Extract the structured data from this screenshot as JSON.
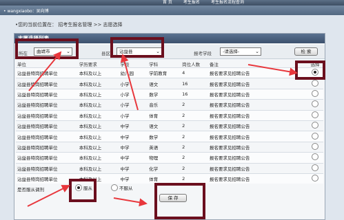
{
  "topbar": {
    "tabs": [
      "首 页",
      "考生报名",
      "考生报名流程查询"
    ]
  },
  "subbar": {
    "user": "• wangxiaobo：吴向博"
  },
  "breadcrumb": "•您的当前位置在：   招考生报名管理 >> 志愿选择",
  "panel_title": "志愿选择列表",
  "filters": {
    "region_label": "所在",
    "region_value": "曲靖市",
    "county_label": "县区",
    "county_value": "沾益县",
    "subject_label": "报考学段",
    "subject_value": "-请选择-",
    "query_label": "检 索"
  },
  "table": {
    "headers": [
      "单位",
      "学历要求",
      "学段",
      "学科",
      "岗位人数",
      "备注",
      "选择"
    ],
    "rows": [
      [
        "沾益县特岗招聘单位",
        "本科及以上",
        "幼儿园",
        "学前教育",
        "4",
        "报名要求见招聘公告",
        "selected"
      ],
      [
        "沾益县特岗招聘单位",
        "本科及以上",
        "小学",
        "语文",
        "16",
        "报名要求见招聘公告",
        ""
      ],
      [
        "沾益县特岗招聘单位",
        "本科及以上",
        "小学",
        "数学",
        "16",
        "报名要求见招聘公告",
        ""
      ],
      [
        "沾益县特岗招聘单位",
        "本科及以上",
        "小学",
        "音乐",
        "2",
        "报名要求见招聘公告",
        ""
      ],
      [
        "沾益县特岗招聘单位",
        "本科及以上",
        "小学",
        "体育",
        "2",
        "报名要求见招聘公告",
        ""
      ],
      [
        "沾益县特岗招聘单位",
        "本科及以上",
        "中学",
        "语文",
        "2",
        "报名要求见招聘公告",
        ""
      ],
      [
        "沾益县特岗招聘单位",
        "本科及以上",
        "中学",
        "数学",
        "2",
        "报名要求见招聘公告",
        ""
      ],
      [
        "沾益县特岗招聘单位",
        "本科及以上",
        "中学",
        "英语",
        "2",
        "报名要求见招聘公告",
        ""
      ],
      [
        "沾益县特岗招聘单位",
        "本科及以上",
        "中学",
        "物理",
        "2",
        "报名要求见招聘公告",
        ""
      ],
      [
        "沾益县特岗招聘单位",
        "本科及以上",
        "中学",
        "化学",
        "2",
        "报名要求见招聘公告",
        ""
      ],
      [
        "沾益县特岗招聘单位",
        "本科及以上",
        "中学",
        "体育",
        "2",
        "报名要求见招聘公告",
        ""
      ]
    ]
  },
  "footer": {
    "obey_label": "是否服从调剂",
    "yes_label": "服从",
    "no_label": "不服从",
    "save_label": "保 存"
  },
  "colors": {
    "highlight": "#6b0f1e",
    "arrow": "#e8373c",
    "header": "#3c516d"
  }
}
